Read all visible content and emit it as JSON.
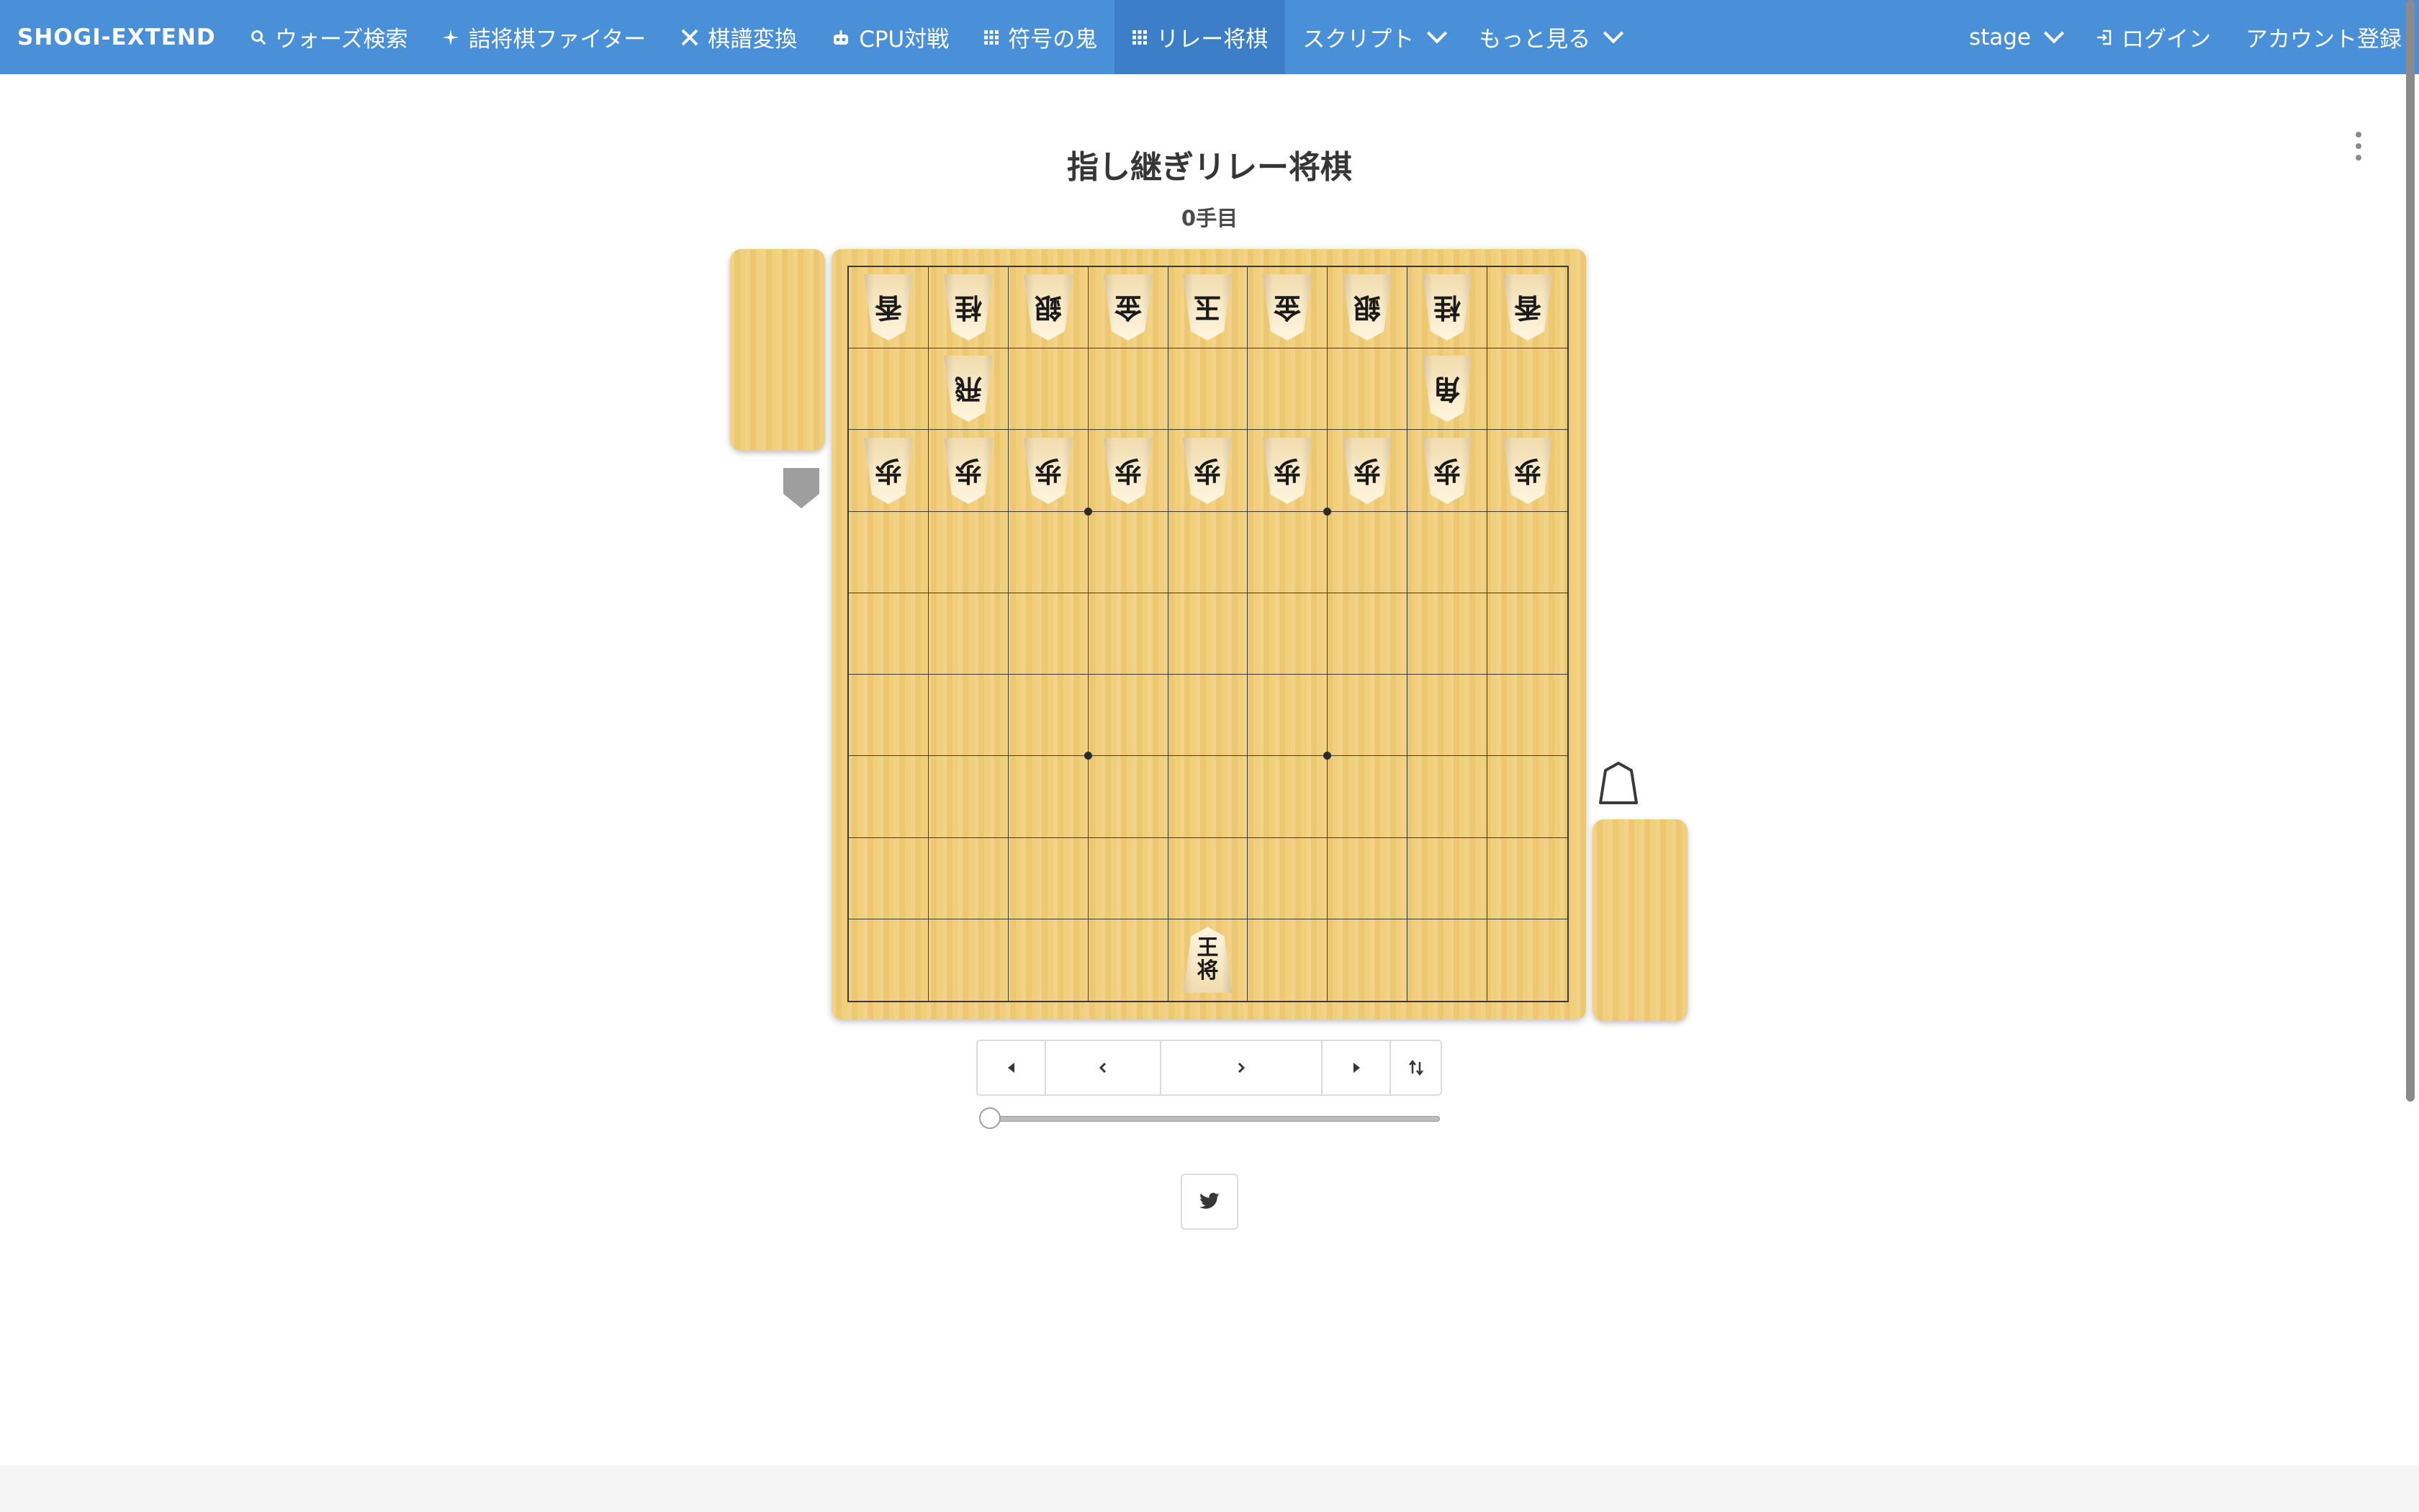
{
  "navbar": {
    "brand": "SHOGI-EXTEND",
    "items": [
      {
        "label": "ウォーズ検索",
        "icon": "magnify-icon",
        "active": false
      },
      {
        "label": "詰将棋ファイター",
        "icon": "sparkle-icon",
        "active": false
      },
      {
        "label": "棋譜変換",
        "icon": "tools-icon",
        "active": false
      },
      {
        "label": "CPU対戦",
        "icon": "robot-icon",
        "active": false
      },
      {
        "label": "符号の鬼",
        "icon": "apps-icon",
        "active": false
      },
      {
        "label": "リレー将棋",
        "icon": "apps-icon",
        "active": true
      },
      {
        "label": "スクリプト",
        "icon": "chevron-down-icon",
        "active": false
      },
      {
        "label": "もっと見る",
        "icon": "chevron-down-icon",
        "active": false
      }
    ],
    "right": {
      "env_label": "stage",
      "login_label": "ログイン",
      "signup_label": "アカウント登録"
    }
  },
  "main": {
    "title": "指し継ぎリレー将棋",
    "turn_label": "0手目"
  },
  "board": {
    "gote_rows": [
      [
        "香",
        "桂",
        "銀",
        "金",
        "玉",
        "金",
        "銀",
        "桂",
        "香"
      ],
      [
        "",
        "飛",
        "",
        "",
        "",
        "",
        "",
        "角",
        ""
      ],
      [
        "歩",
        "歩",
        "歩",
        "歩",
        "歩",
        "歩",
        "歩",
        "歩",
        "歩"
      ]
    ],
    "sente_pieces": [
      {
        "row": 9,
        "col": 5,
        "label": "王将"
      }
    ],
    "star_points": "4-4, 4-7, 7-4, 7-7",
    "gote_hand": [],
    "sente_hand": []
  },
  "controls": {
    "first_icon": "skip-back-icon",
    "prev_icon": "chevron-left-icon",
    "next_icon": "chevron-right-icon",
    "last_icon": "skip-forward-icon",
    "flip_icon": "swap-vertical-icon",
    "slider_value": 0
  },
  "share": {
    "icon": "twitter-icon"
  },
  "colors": {
    "navbar": "#4a90d9",
    "navbar_active": "#3c7fc8",
    "board": "#f0cd78"
  }
}
